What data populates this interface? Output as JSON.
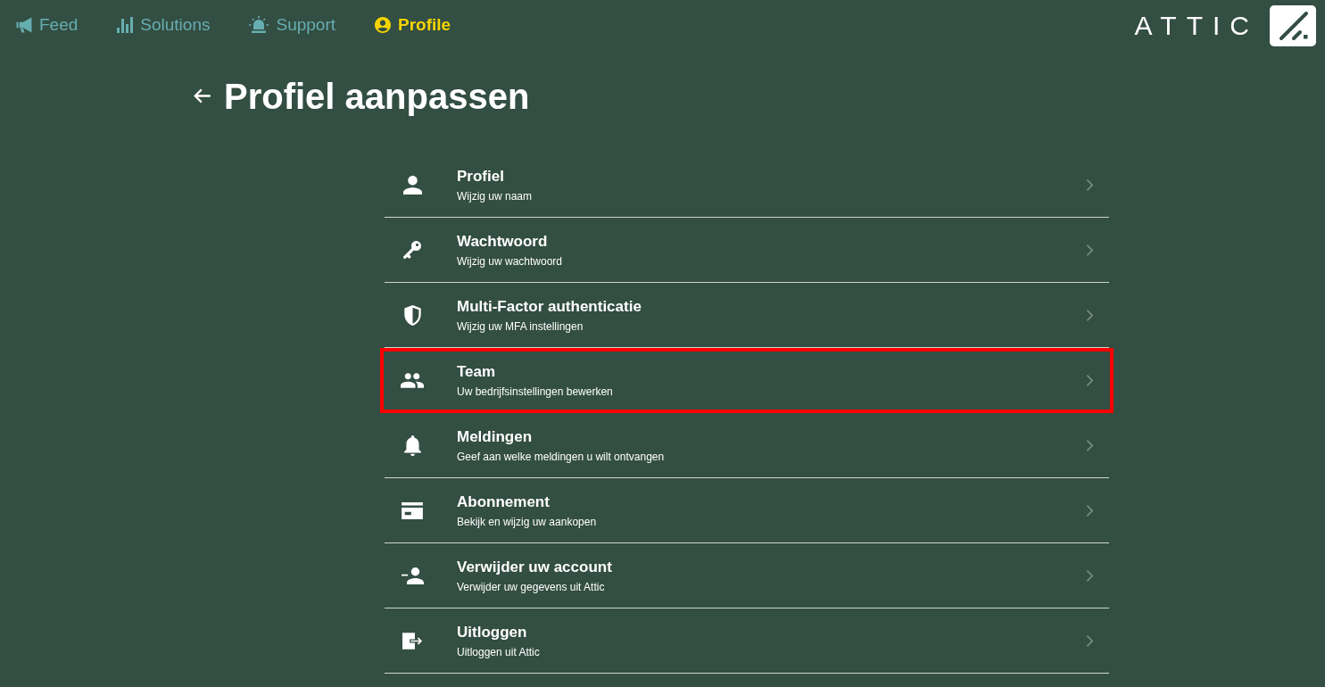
{
  "nav": {
    "items": [
      {
        "label": "Feed",
        "selected": false
      },
      {
        "label": "Solutions",
        "selected": false
      },
      {
        "label": "Support",
        "selected": false
      },
      {
        "label": "Profile",
        "selected": true
      }
    ]
  },
  "logo": {
    "text": "ATTIC"
  },
  "page": {
    "title": "Profiel aanpassen"
  },
  "menu": {
    "items": [
      {
        "title": "Profiel",
        "subtitle": "Wijzig uw naam",
        "highlighted": false
      },
      {
        "title": "Wachtwoord",
        "subtitle": "Wijzig uw wachtwoord",
        "highlighted": false
      },
      {
        "title": "Multi-Factor authenticatie",
        "subtitle": "Wijzig uw MFA instellingen",
        "highlighted": false
      },
      {
        "title": "Team",
        "subtitle": "Uw bedrijfsinstellingen bewerken",
        "highlighted": true
      },
      {
        "title": "Meldingen",
        "subtitle": "Geef aan welke meldingen u wilt ontvangen",
        "highlighted": false
      },
      {
        "title": "Abonnement",
        "subtitle": "Bekijk en wijzig uw aankopen",
        "highlighted": false
      },
      {
        "title": "Verwijder uw account",
        "subtitle": "Verwijder uw gegevens uit Attic",
        "highlighted": false
      },
      {
        "title": "Uitloggen",
        "subtitle": "Uitloggen uit Attic",
        "highlighted": false
      }
    ]
  }
}
